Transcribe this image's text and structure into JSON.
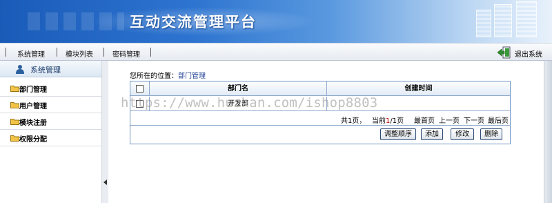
{
  "header": {
    "title": "互动交流管理平台"
  },
  "menu": {
    "items": [
      "系统管理",
      "模块列表",
      "密码管理"
    ],
    "exit_label": "退出系统"
  },
  "sidebar": {
    "title": "系统管理",
    "items": [
      "部门管理",
      "用户管理",
      "模块注册",
      "权限分配"
    ]
  },
  "breadcrumb": {
    "prefix": "您所在的位置：",
    "current": "部门管理"
  },
  "table": {
    "columns": [
      "部门名",
      "创建时间"
    ],
    "rows": [
      {
        "name": "开发部",
        "created": ""
      }
    ]
  },
  "pager": {
    "total": "共1页，",
    "current_prefix": "当前",
    "current_page": "1",
    "current_suffix": "/1页",
    "first": "最首页",
    "prev": "上一页",
    "next": "下一页",
    "last": "最后页"
  },
  "buttons": {
    "reorder": "调整顺序",
    "add": "添加",
    "edit": "修改",
    "delete": "删除"
  },
  "watermark": "https://www.huzhan.com/ishop8803",
  "colors": {
    "header_blue": "#1a5bb8",
    "grid_border": "#6f95c4",
    "current_page": "#c00000"
  }
}
